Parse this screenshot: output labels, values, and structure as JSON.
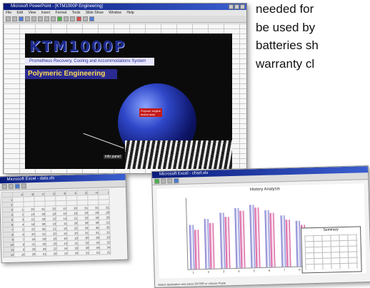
{
  "page_text": {
    "lines": [
      "needed for",
      "be used by",
      "batteries sh",
      "warranty cl"
    ]
  },
  "window_main": {
    "title": "Microsoft PowerPoint - [KTM1000P Engineering]",
    "menu": [
      "File",
      "Edit",
      "View",
      "Insert",
      "Format",
      "Tools",
      "Slide Show",
      "Window",
      "Help"
    ],
    "slide": {
      "logo_text": "KTM1000P",
      "subtitle": "Prometheus Recovery, Cooling and Accommodations System",
      "heading": "Polymeric Engineering",
      "sphere_label_lines": [
        "Polymer engine",
        "tested data"
      ],
      "pointer_label": "info panel"
    },
    "colors": {
      "slide_bg": "#0b0b0b",
      "logo": "#1d2a8a",
      "heading_bg": "#2a2a90",
      "heading_text": "#ffdd55",
      "accent_red": "#c41a1a"
    }
  },
  "window_spreadsheet": {
    "title": "Microsoft Excel - data.xls",
    "rows": [
      [
        "",
        "A",
        "B",
        "C",
        "D",
        "E",
        "F",
        "G",
        "H",
        "I"
      ],
      [
        "1",
        "",
        "",
        "",
        "",
        "",
        "",
        "",
        "",
        ""
      ],
      [
        "2",
        "",
        "",
        "",
        "",
        "",
        "",
        "",
        "",
        ""
      ],
      [
        "3",
        "1",
        "20",
        "31",
        "20",
        "12",
        "20",
        "31",
        "31",
        "31"
      ],
      [
        "4",
        "2",
        "19",
        "28",
        "18",
        "10",
        "19",
        "29",
        "28",
        "28"
      ],
      [
        "5",
        "3",
        "21",
        "33",
        "22",
        "14",
        "21",
        "32",
        "33",
        "33"
      ],
      [
        "6",
        "4",
        "18",
        "30",
        "19",
        "11",
        "20",
        "30",
        "30",
        "31"
      ],
      [
        "7",
        "5",
        "22",
        "35",
        "21",
        "13",
        "22",
        "34",
        "35",
        "35"
      ],
      [
        "8",
        "6",
        "20",
        "31",
        "20",
        "12",
        "20",
        "31",
        "31",
        "31"
      ],
      [
        "9",
        "7",
        "19",
        "29",
        "18",
        "10",
        "19",
        "30",
        "29",
        "29"
      ],
      [
        "10",
        "8",
        "21",
        "32",
        "20",
        "13",
        "21",
        "32",
        "32",
        "32"
      ],
      [
        "11",
        "9",
        "23",
        "34",
        "22",
        "15",
        "23",
        "33",
        "34",
        "34"
      ],
      [
        "12",
        "10",
        "20",
        "31",
        "20",
        "12",
        "20",
        "31",
        "31",
        "31"
      ]
    ]
  },
  "window_chart": {
    "title": "Microsoft Excel - chart.xls",
    "chart_title": "History Analysis",
    "status_text": "Select destination and press ENTER or choose Paste",
    "legend_title": "Summary",
    "chart_data": {
      "type": "bar",
      "title": "History Analysis",
      "categories": [
        "1",
        "2",
        "3",
        "4",
        "5",
        "6",
        "7",
        "8"
      ],
      "series": [
        {
          "values": [
            62,
            70,
            78,
            84,
            88,
            80,
            72,
            64
          ]
        },
        {
          "values": [
            55,
            64,
            72,
            80,
            84,
            76,
            66,
            58
          ]
        }
      ],
      "colors": [
        "#6e6ecc",
        "#cf3a8a"
      ]
    }
  }
}
